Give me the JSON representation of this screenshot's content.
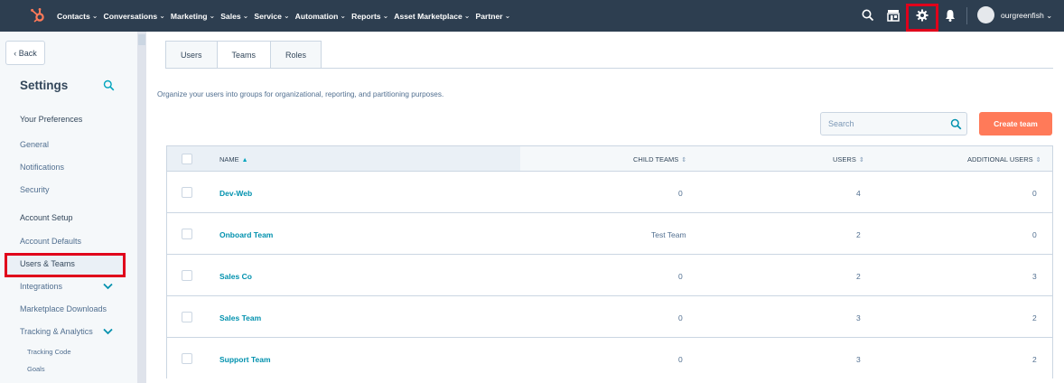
{
  "colors": {
    "nav_bg": "#2d3e50",
    "accent_orange": "#ff7a59",
    "link": "#0091ae",
    "highlight_red": "#e0001b",
    "sidebar_bg": "#f5f8fa"
  },
  "nav": {
    "menu": [
      {
        "label": "Contacts"
      },
      {
        "label": "Conversations"
      },
      {
        "label": "Marketing"
      },
      {
        "label": "Sales"
      },
      {
        "label": "Service"
      },
      {
        "label": "Automation"
      },
      {
        "label": "Reports"
      },
      {
        "label": "Asset Marketplace"
      },
      {
        "label": "Partner"
      }
    ],
    "icons": [
      "search-icon",
      "marketplace-icon",
      "gear-icon",
      "bell-icon"
    ],
    "account": "ourgreenfish"
  },
  "sidebar": {
    "back_label": "Back",
    "title": "Settings",
    "items": [
      {
        "label": "Your Preferences"
      },
      {
        "label": "General"
      },
      {
        "label": "Notifications"
      },
      {
        "label": "Security"
      },
      {
        "label": "Account Setup"
      },
      {
        "label": "Account Defaults"
      },
      {
        "label": "Users & Teams"
      },
      {
        "label": "Integrations"
      },
      {
        "label": "Marketplace Downloads"
      },
      {
        "label": "Tracking & Analytics"
      },
      {
        "label": "Tracking Code"
      },
      {
        "label": "Goals"
      }
    ]
  },
  "main": {
    "tabs": [
      {
        "label": "Users"
      },
      {
        "label": "Teams"
      },
      {
        "label": "Roles"
      }
    ],
    "active_tab": "Teams",
    "description": "Organize your users into groups for organizational, reporting, and partitioning purposes.",
    "search": {
      "placeholder": "Search"
    },
    "create_button": "Create team",
    "table": {
      "columns": [
        "NAME",
        "CHILD TEAMS",
        "USERS",
        "ADDITIONAL USERS"
      ],
      "rows": [
        {
          "name": "Dev-Web",
          "child_teams": "0",
          "users": "4",
          "additional": "0"
        },
        {
          "name": "Onboard Team",
          "child_teams": "Test Team",
          "users": "2",
          "additional": "0"
        },
        {
          "name": "Sales Co",
          "child_teams": "0",
          "users": "2",
          "additional": "3"
        },
        {
          "name": "Sales Team",
          "child_teams": "0",
          "users": "3",
          "additional": "2"
        },
        {
          "name": "Support Team",
          "child_teams": "0",
          "users": "3",
          "additional": "2"
        }
      ]
    }
  }
}
